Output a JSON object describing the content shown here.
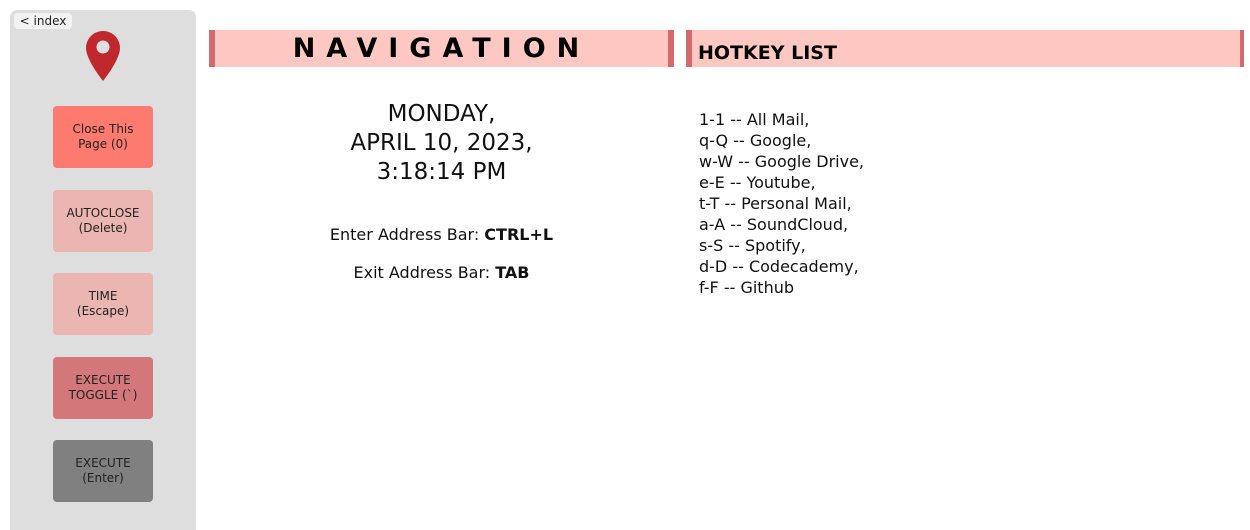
{
  "sidebar": {
    "index_link": "< index",
    "icon": "map-pin-icon",
    "buttons": [
      {
        "label": "Close This\nPage (0)",
        "color": "#fd7b6e"
      },
      {
        "label": "AUTOCLOSE\n(Delete)",
        "color": "#ebb6b1"
      },
      {
        "label": "TIME\n(Escape)",
        "color": "#ebb6b1"
      },
      {
        "label": "EXECUTE\nTOGGLE (`)",
        "color": "#d4777a"
      },
      {
        "label": "EXECUTE\n(Enter)",
        "color": "#808080"
      }
    ]
  },
  "navigation": {
    "title": "NAVIGATION",
    "date_line1": "MONDAY,",
    "date_line2": "APRIL 10, 2023,",
    "time": "3:18:14 PM",
    "enter_label": "Enter Address Bar: ",
    "enter_key": "CTRL+L",
    "exit_label": "Exit Address Bar: ",
    "exit_key": "TAB"
  },
  "hotkeys": {
    "title": "HOTKEY LIST",
    "items": [
      "1-1 -- All Mail,",
      "q-Q -- Google,",
      "w-W -- Google Drive,",
      "e-E -- Youtube,",
      "t-T -- Personal Mail,",
      "a-A -- SoundCloud,",
      "s-S -- Spotify,",
      "d-D -- Codecademy,",
      "f-F -- Github"
    ]
  },
  "colors": {
    "header_bg": "#fec8c2",
    "header_border": "#d36a6d",
    "sidebar_bg": "#dedede",
    "pin": "#c0282d"
  }
}
